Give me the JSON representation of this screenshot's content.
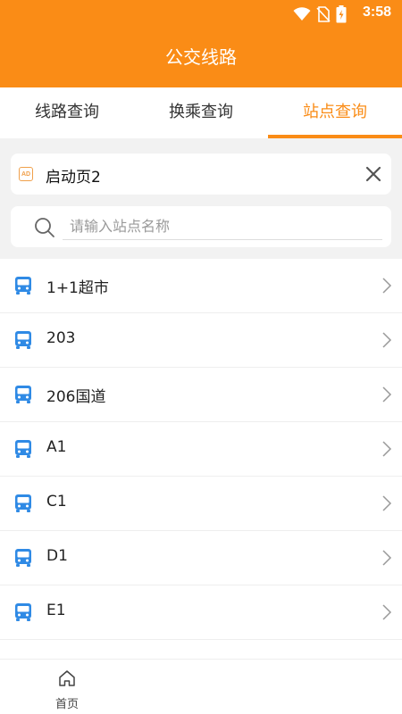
{
  "status_bar": {
    "time": "3:58",
    "icons": [
      "wifi-icon",
      "no-sim-icon",
      "battery-charging-icon"
    ]
  },
  "header": {
    "title": "公交线路",
    "accent_color": "#fa8c16"
  },
  "tabs": [
    {
      "label": "线路查询",
      "active": false
    },
    {
      "label": "换乘查询",
      "active": false
    },
    {
      "label": "站点查询",
      "active": true
    }
  ],
  "ad": {
    "badge": "AD",
    "text": "启动页2"
  },
  "search": {
    "placeholder": "请输入站点名称",
    "value": ""
  },
  "stations": [
    {
      "name": "1+1超市"
    },
    {
      "name": "203"
    },
    {
      "name": "206国道"
    },
    {
      "name": "A1"
    },
    {
      "name": "C1"
    },
    {
      "name": "D1"
    },
    {
      "name": "E1"
    }
  ],
  "bottom_nav": {
    "home_label": "首页"
  },
  "colors": {
    "icon_blue": "#2f8ae5",
    "tab_active": "#fa8c16"
  }
}
